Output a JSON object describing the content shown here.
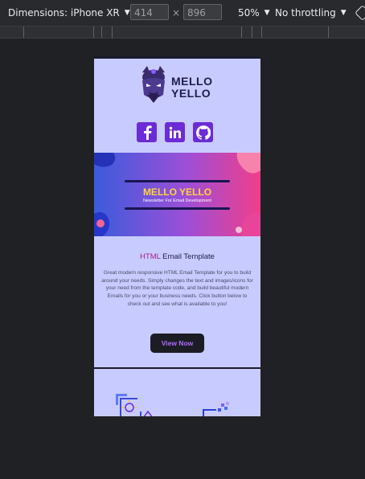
{
  "toolbar": {
    "dimensions_label": "Dimensions: iPhone XR",
    "width_value": "414",
    "height_value": "896",
    "times_sign": "×",
    "zoom": "50%",
    "throttling": "No throttling",
    "icons": [
      "chevron-down-icon",
      "rotate-icon"
    ]
  },
  "email": {
    "brand_line1": "MELLO",
    "brand_line2": "YELLO",
    "socials": [
      "facebook-icon",
      "linkedin-icon",
      "github-icon"
    ],
    "banner": {
      "title": "MELLO YELLO",
      "subtitle": "Newsletter For Email Development"
    },
    "section": {
      "title_highlight": "HTML",
      "title_rest": " Email Template",
      "description": "Great modern responsive HTML Email Template for you to build around your needs. Simply changes the text and images/icons for your need from the template code, and build beautiful modern Emails for you or your business needs. Click button below to check out and see what is available to you!"
    },
    "button_label": "View Now"
  },
  "colors": {
    "accent": "#6b2bd6",
    "background": "#c8cbff",
    "button_bg": "#1c1c24",
    "button_text": "#b06cff",
    "banner_title": "#ffd43b"
  }
}
